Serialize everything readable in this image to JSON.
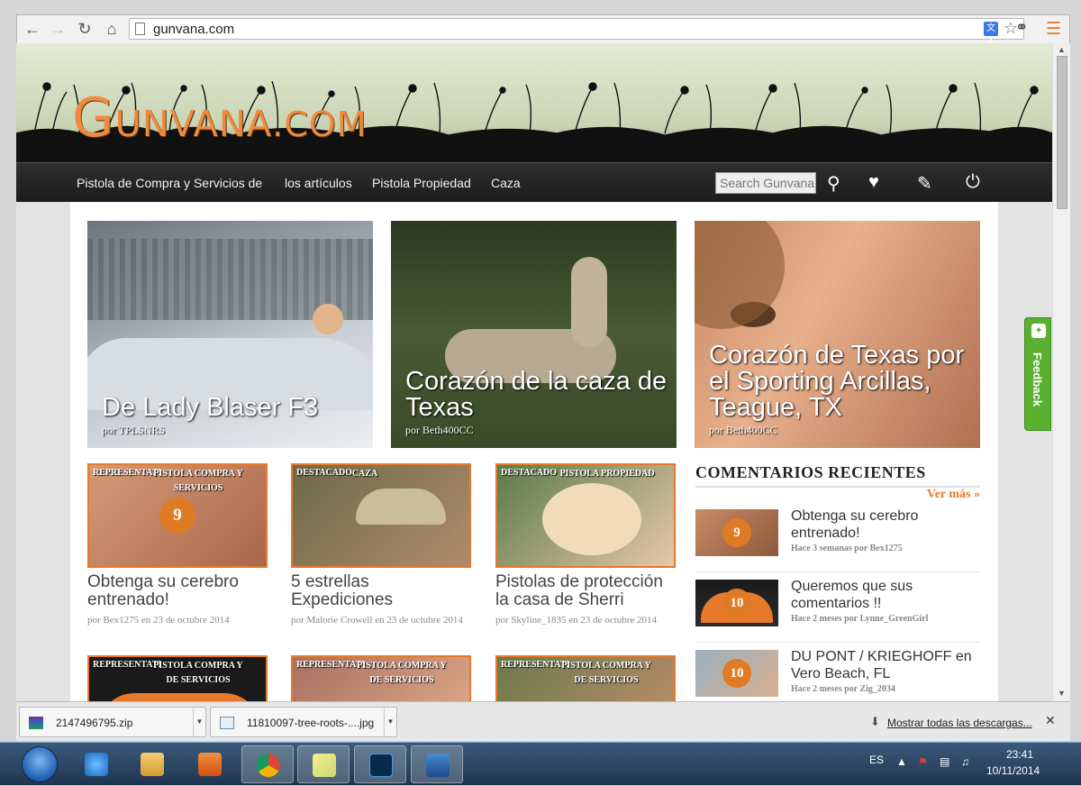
{
  "browser": {
    "url": "gunvana.com",
    "translate_label": "文A"
  },
  "site": {
    "logo": {
      "first": "G",
      "rest": "UNVANA",
      "dot": ".",
      "com": "COM"
    },
    "nav": [
      "Pistola de Compra y Servicios de",
      "los artículos",
      "Pistola Propiedad",
      "Caza"
    ],
    "search_placeholder": "Search Gunvana",
    "features": [
      {
        "title": "De Lady Blaser F3",
        "by": "por TPLSNRS"
      },
      {
        "title": "Corazón de la caza de Texas",
        "by": "por Beth400CC"
      },
      {
        "title": "Corazón de Texas por el Sporting Arcillas, Teague, TX",
        "by": "por Beth400CC"
      }
    ],
    "cards": [
      {
        "tag": "REPRESENTATI",
        "tag2": "PISTOLA COMPRA Y SERVICIOS",
        "count": "9",
        "title": "Obtenga su cerebro entrenado!",
        "meta": "por Bex1275 en 23 de octubre 2014"
      },
      {
        "tag": "DESTACADO",
        "tag2": "CAZA",
        "title": "5 estrellas Expediciones",
        "meta": "por Malorie Crowell en 23 de octubre 2014"
      },
      {
        "tag": "DESTACADO",
        "tag2": "PISTOLA PROPIEDAD",
        "title": "Pistolas de protección la casa de Sherri",
        "meta": "por Skyline_1835 en 23 de octubre 2014"
      },
      {
        "tag": "REPRESENTATI",
        "tag2": "PISTOLA COMPRA Y DE SERVICIOS"
      },
      {
        "tag": "REPRESENTATI",
        "tag2": "PISTOLA COMPRA Y DE SERVICIOS"
      },
      {
        "tag": "REPRESENTATI",
        "tag2": "PISTOLA COMPRA Y DE SERVICIOS"
      }
    ],
    "sidebar": {
      "heading": "COMENTARIOS RECIENTES",
      "more": "Ver más »",
      "comments": [
        {
          "count": "9",
          "title": "Obtenga su cerebro entrenado!",
          "meta": "Hace 3 semanas por Bex1275"
        },
        {
          "count": "10",
          "title": "Queremos que sus comentarios !!",
          "meta": "Hace 2 meses por Lynne_GreenGirl"
        },
        {
          "count": "10",
          "title": "DU PONT / KRIEGHOFF en Vero Beach, FL",
          "meta": "Hace 2 meses por Zig_2034"
        }
      ]
    },
    "feedback": "Feedback"
  },
  "downloads": {
    "items": [
      "2147496795.zip",
      "11810097-tree-roots-....jpg"
    ],
    "show_all": "Mostrar todas las descargas...",
    "close": "✕"
  },
  "taskbar": {
    "lang": "ES",
    "time": "23:41",
    "date": "10/11/2014"
  }
}
